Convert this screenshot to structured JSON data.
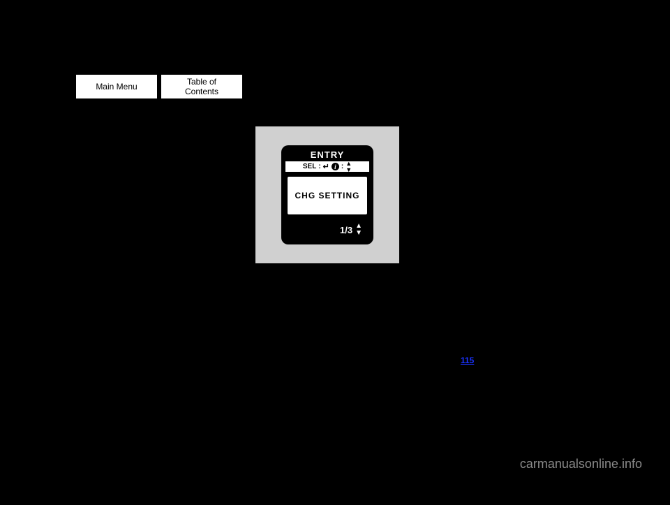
{
  "nav": {
    "main_menu": "Main Menu",
    "toc": "Table of Contents"
  },
  "device": {
    "title": "ENTRY",
    "sel_label": "SEL",
    "screen": "CHG SETTING",
    "page": "1/3"
  },
  "link": {
    "page_ref": "115"
  },
  "watermark": "carmanualsonline.info"
}
